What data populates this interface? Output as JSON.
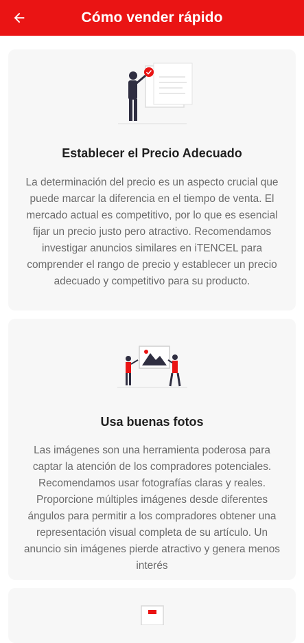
{
  "header": {
    "title": "Cómo vender rápido",
    "background_color": "#ea1414",
    "back_icon": "arrow-left-icon"
  },
  "cards": [
    {
      "title": "Establecer el Precio Adecuado",
      "body": "La determinación del precio es un aspecto crucial que puede marcar la diferencia en el tiempo de venta. El mercado actual es competitivo, por lo que es esencial fijar un precio justo pero atractivo. Recomendamos investigar anuncios similares en iTENCEL para comprender el rango de precio y establecer un precio adecuado y competitivo para su producto.",
      "illustration": "person-with-price-board-illustration"
    },
    {
      "title": "Usa buenas fotos",
      "body": "Las imágenes son una herramienta poderosa para captar la atención de los compradores potenciales. Recomendamos usar fotografías claras y reales. Proporcione múltiples imágenes desde diferentes ángulos para permitir a los compradores obtener una representación visual completa de su artículo. Un anuncio sin imágenes pierde atractivo y genera menos interés",
      "illustration": "two-people-with-photo-frame-illustration"
    },
    {
      "illustration": "document-illustration"
    }
  ],
  "colors": {
    "accent": "#ea1414",
    "card_bg": "#f7f7f7",
    "text_title": "#1f1f1f",
    "text_body": "#6a6a6a"
  }
}
